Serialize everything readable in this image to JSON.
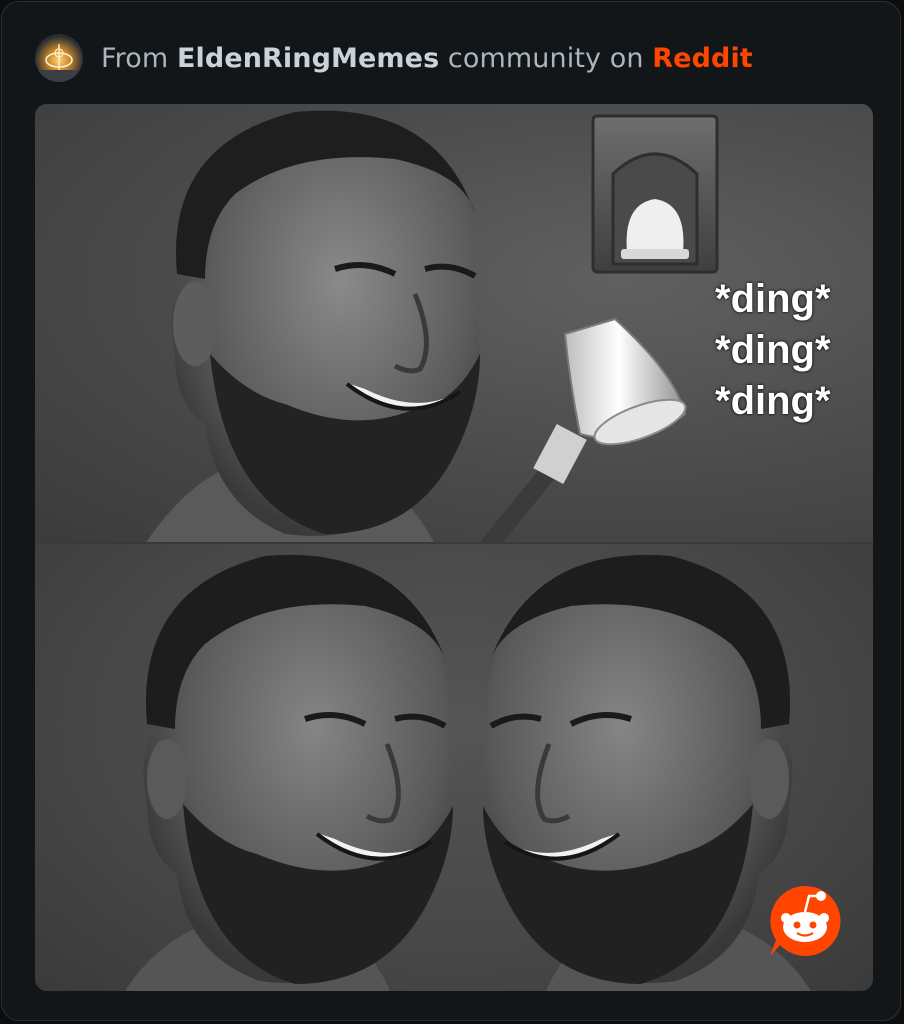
{
  "header": {
    "prefix": "From ",
    "community": "EldenRingMemes",
    "middle": " community on ",
    "platform": "Reddit",
    "avatar_icon": "elden-ring-icon"
  },
  "meme": {
    "ding_lines": [
      "*ding*",
      "*ding*",
      "*ding*"
    ],
    "top_panel": "chad-face-holding-bell",
    "bottom_panel": "two-chad-faces-facing-each-other",
    "inset_image": "stone-tablet-with-bell-icon",
    "watermark_icon": "reddit-logo-icon"
  },
  "colors": {
    "background": "#0b0d0f",
    "card": "#121619",
    "reddit_orange": "#ff4500",
    "muted_text": "#aab5bd"
  }
}
